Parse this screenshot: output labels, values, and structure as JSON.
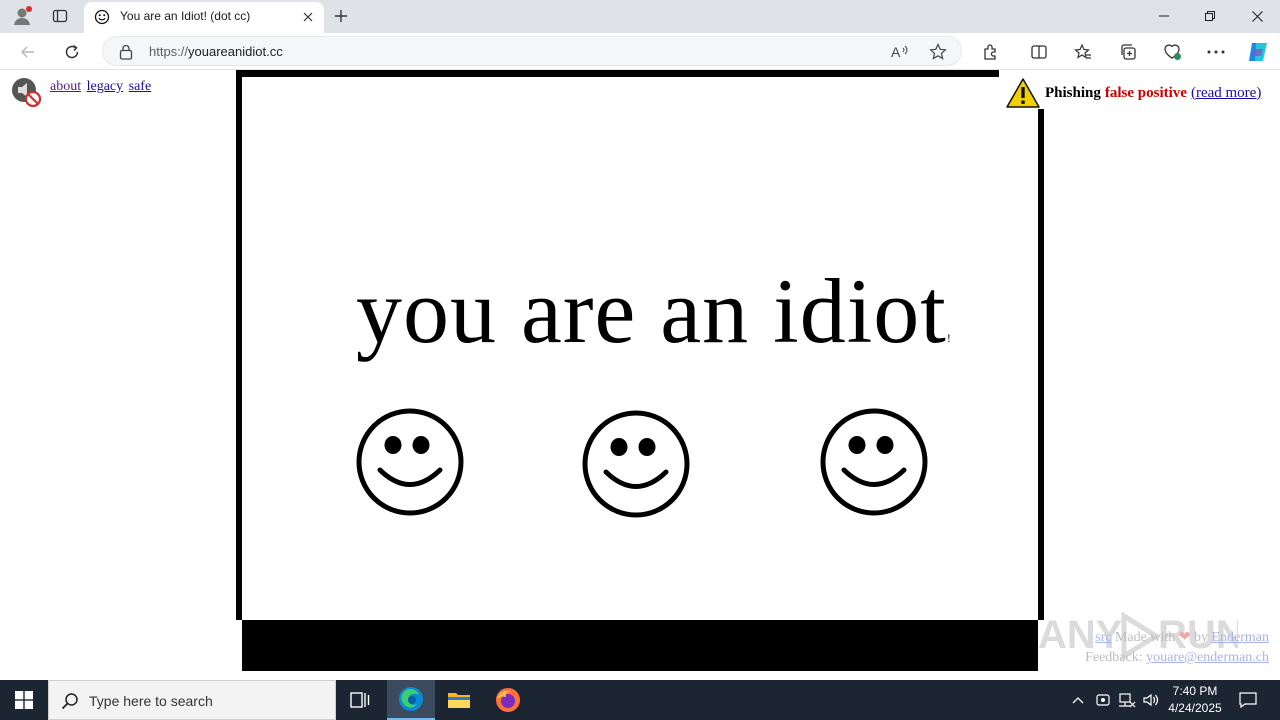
{
  "browser": {
    "tab": {
      "title": "You are an Idiot! (dot cc)"
    },
    "address": {
      "protocol": "https://",
      "domain": "youareanidiot.cc"
    }
  },
  "page": {
    "nav_links": [
      "about",
      "legacy",
      "safe"
    ],
    "warning": {
      "label": "Phishing",
      "highlight": "false positive",
      "link": "(read more)",
      "highlight_color": "#cc0000"
    },
    "headline": "you are an idiot",
    "headline_mark": "!",
    "footer": {
      "line1_link": "src",
      "line1_text": "Made with",
      "line1_by": "by",
      "line1_author": "Enderman",
      "line2_label": "Feedback:",
      "line2_email": "youare@enderman.ch"
    }
  },
  "taskbar": {
    "search_placeholder": "Type here to search",
    "time": "7:40 PM",
    "date": "4/24/2025",
    "apps": [
      "task-view-icon",
      "edge-icon",
      "file-explorer-icon",
      "firefox-icon"
    ]
  },
  "colors": {
    "taskbar_bg": "#1c2633",
    "titlebar_bg": "#dfe3e8",
    "link": "#1a0dab"
  }
}
